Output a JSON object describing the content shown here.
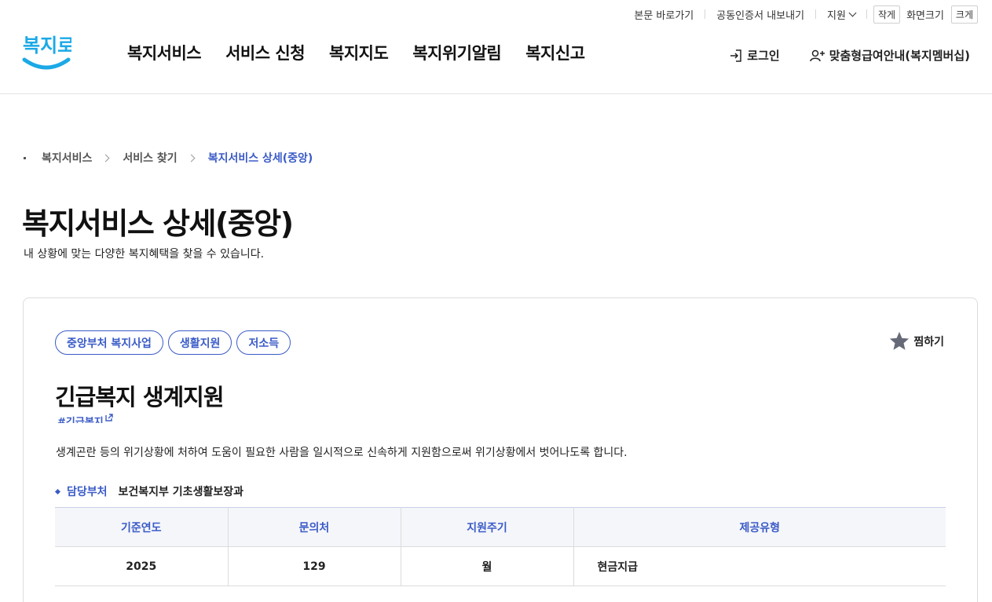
{
  "utility": {
    "skip_link": "본문 바로가기",
    "cert_export": "공동인증서 내보내기",
    "support": "지원",
    "font_small": "작게",
    "font_label": "화면크기",
    "font_large": "크게"
  },
  "header": {
    "logo_text": "복지로",
    "nav": [
      "복지서비스",
      "서비스 신청",
      "복지지도",
      "복지위기알림",
      "복지신고"
    ],
    "login": "로그인",
    "membership": "맞춤형급여안내(복지멤버십)"
  },
  "breadcrumb": [
    "복지서비스",
    "서비스 찾기",
    "복지서비스 상세(중앙)"
  ],
  "page": {
    "title": "복지서비스 상세(중앙)",
    "description": "내 상황에 맞는 다양한 복지혜택을 찾을 수 있습니다."
  },
  "service": {
    "tags": [
      "중앙부처 복지사업",
      "생활지원",
      "저소득"
    ],
    "favorite": "찜하기",
    "title": "긴급복지 생계지원",
    "hashtag": "#긴급복지",
    "description": "생계곤란 등의 위기상황에 처하여 도움이 필요한 사람을 일시적으로 신속하게 지원함으로써 위기상황에서 벗어나도록 합니다.",
    "dept_label": "담당부처",
    "dept_value": "보건복지부 기초생활보장과",
    "table": {
      "headers": [
        "기준연도",
        "문의처",
        "지원주기",
        "제공유형"
      ],
      "row": [
        "2025",
        "129",
        "월",
        "현금지급"
      ]
    }
  },
  "colors": {
    "accent": "#3a5bc7",
    "logo": "#1ba9e6"
  }
}
